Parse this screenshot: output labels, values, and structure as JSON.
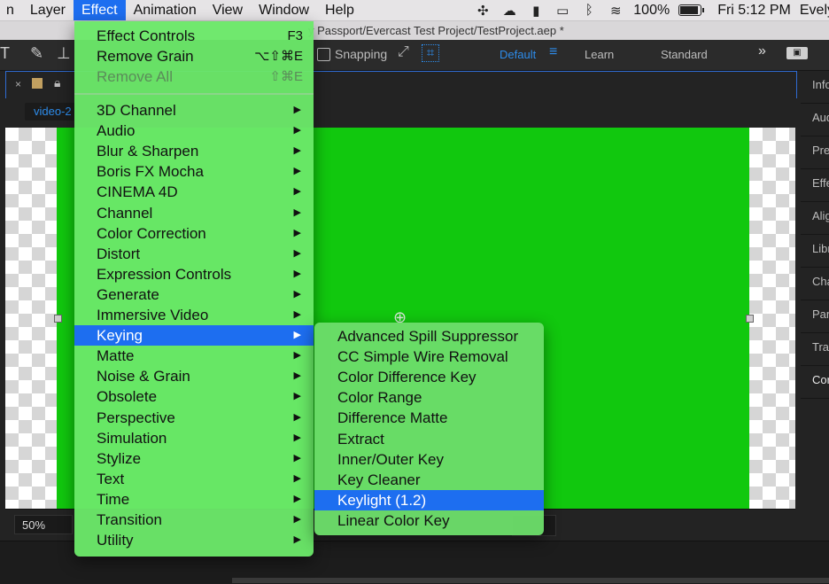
{
  "menubar": {
    "items": [
      "n",
      "Layer",
      "Effect",
      "Animation",
      "View",
      "Window",
      "Help"
    ],
    "active_index": 2,
    "battery_text": "100%",
    "battery_level": 1.0,
    "clock": "Fri 5:12 PM",
    "user": "Evely",
    "status_icons": [
      "fingerprint-icon",
      "creative-cloud-icon",
      "bookmark-icon",
      "display-icon",
      "bluetooth-icon",
      "wifi-icon"
    ]
  },
  "window": {
    "title": "y Passport/Evercast Test Project/TestProject.aep *"
  },
  "toolbar": {
    "snapping_label": "Snapping",
    "workspaces": [
      "Default",
      "Learn",
      "Standard"
    ],
    "more": "»"
  },
  "composition": {
    "tab_label": "video-2",
    "zoom": "50%",
    "frame_color": "#11c80e"
  },
  "right_panels": [
    "Info",
    "Aud",
    "Pre",
    "Effe",
    "Alig",
    "Libr",
    "Cha",
    "Par",
    "Tra",
    "Cor"
  ],
  "effect_menu": {
    "top_items": [
      {
        "label": "Effect Controls",
        "shortcut": "F3",
        "disabled": false
      },
      {
        "label": "Remove Grain",
        "shortcut": "⌥⇧⌘E",
        "disabled": false
      },
      {
        "label": "Remove All",
        "shortcut": "⇧⌘E",
        "disabled": true
      }
    ],
    "categories": [
      "3D Channel",
      "Audio",
      "Blur & Sharpen",
      "Boris FX Mocha",
      "CINEMA 4D",
      "Channel",
      "Color Correction",
      "Distort",
      "Expression Controls",
      "Generate",
      "Immersive Video",
      "Keying",
      "Matte",
      "Noise & Grain",
      "Obsolete",
      "Perspective",
      "Simulation",
      "Stylize",
      "Text",
      "Time",
      "Transition",
      "Utility"
    ],
    "highlighted_category": "Keying",
    "submenu_arrow": "▶"
  },
  "keying_submenu": {
    "items": [
      "Advanced Spill Suppressor",
      "CC Simple Wire Removal",
      "Color Difference Key",
      "Color Range",
      "Difference Matte",
      "Extract",
      "Inner/Outer Key",
      "Key Cleaner",
      "Keylight (1.2)",
      "Linear Color Key"
    ],
    "highlighted": "Keylight (1.2)"
  },
  "colors": {
    "menu_bg": "#6be869",
    "highlight": "#1d6ef0",
    "accent_blue": "#2d8ceb"
  }
}
